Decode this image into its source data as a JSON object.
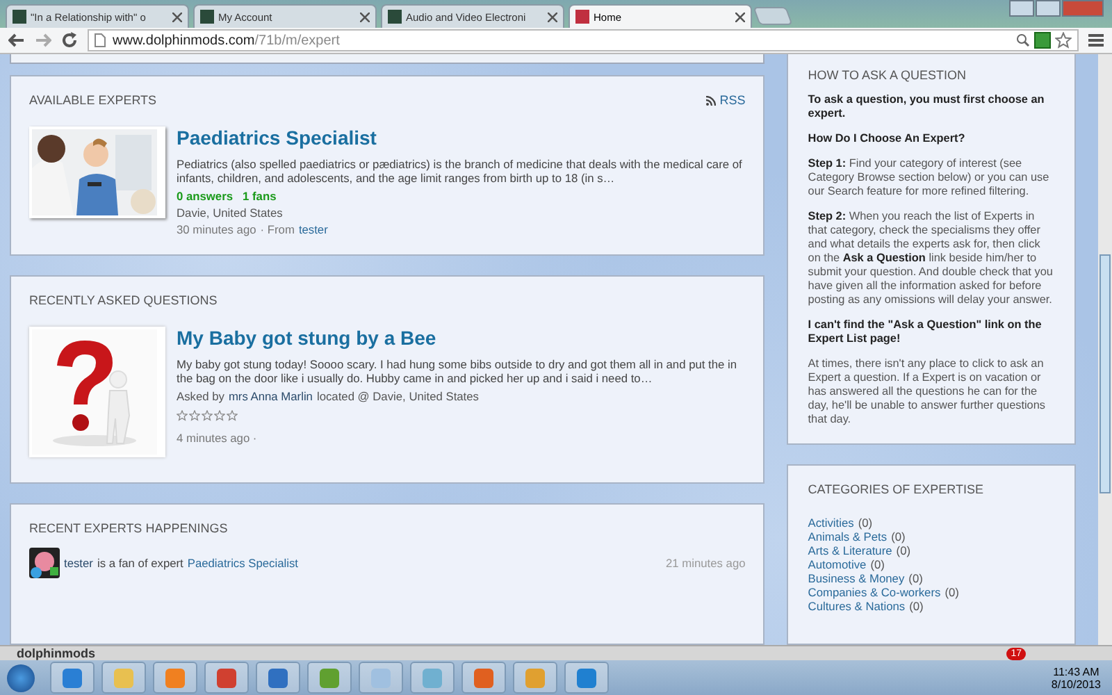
{
  "browser": {
    "tabs": [
      {
        "title": "\"In a Relationship with\" o",
        "selected": false
      },
      {
        "title": "My Account",
        "selected": false
      },
      {
        "title": "Audio and Video Electroni",
        "selected": false
      },
      {
        "title": "Home",
        "selected": true
      }
    ],
    "url": {
      "domain": "www.dolphinmods.com",
      "path": "/71b/m/expert"
    }
  },
  "available_experts": {
    "heading": "AVAILABLE EXPERTS",
    "rss": "RSS",
    "expert": {
      "kind": "picture",
      "title": "Paediatrics Specialist",
      "description": "Pediatrics (also spelled paediatrics or pædiatrics) is the branch of medicine that deals with the medical care of infants, children, and adolescents, and the age limit ranges from birth up to 18 (in s…",
      "answers": "0 answers",
      "fans": "1 fans",
      "location": "Davie, United States",
      "time": "30 minutes ago",
      "from_label": "· From",
      "from_user": "tester"
    }
  },
  "recent_questions": {
    "heading": "RECENTLY ASKED QUESTIONS",
    "question": {
      "kind": "picture",
      "title": "My Baby got stung by a Bee",
      "body": "My baby got stung today! Soooo scary. I had hung some bibs outside to dry and got them all in and put the in the bag on the door like i usually do. Hubby came in and picked her up and i said i need to…",
      "asked_by": "Asked by",
      "user": "mrs Anna Marlin",
      "located": "located @ Davie, United States",
      "stars": 0,
      "time": "4 minutes ago ·"
    }
  },
  "happenings": {
    "heading": "RECENT EXPERTS HAPPENINGS",
    "items": [
      {
        "user": "tester",
        "text": "is a fan of expert",
        "link": "Paediatrics Specialist",
        "time": "21 minutes ago"
      }
    ]
  },
  "how_to": {
    "heading": "HOW TO ASK A QUESTION",
    "paragraphs": [
      "**To ask a question, you must first choose an expert.**",
      "**How Do I Choose An Expert?**",
      "**Step 1:** Find your category of interest (see Category Browse section below) or you can use our Search feature for more refined filtering.",
      "**Step 2:** When you reach the list of Experts in that category, check the specialisms they offer and what details the experts ask for, then click on the **Ask a Question** link beside him/her to submit your question. And double check that you have given all the information asked for before posting as any omissions will delay your answer.",
      "**I can't find the \"Ask a Question\" link on the Expert List page!**",
      "At times, there isn't any place to click to ask an Expert a question. If a Expert is on vacation or has answered all the questions he can for the day, he'll be unable to answer further questions that day."
    ]
  },
  "categories": {
    "heading": "CATEGORIES OF EXPERTISE",
    "items": [
      {
        "name": "Activities",
        "count": "(0)"
      },
      {
        "name": "Animals & Pets",
        "count": "(0)"
      },
      {
        "name": "Arts & Literature",
        "count": "(0)"
      },
      {
        "name": "Automotive",
        "count": "(0)"
      },
      {
        "name": "Business & Money",
        "count": "(0)"
      },
      {
        "name": "Companies & Co-workers",
        "count": "(0)"
      },
      {
        "name": "Cultures & Nations",
        "count": "(0)"
      }
    ]
  },
  "site_bar": {
    "name": "dolphinmods",
    "notifications": "17"
  },
  "taskbar": {
    "time": "11:43 AM",
    "date": "8/10/2013"
  }
}
